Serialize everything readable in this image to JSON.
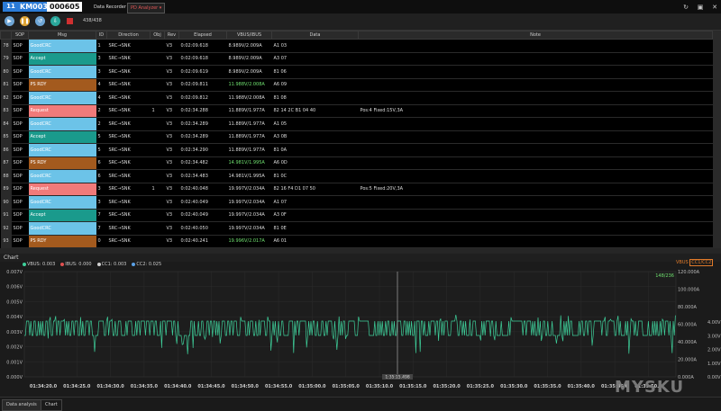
{
  "titlebar": {
    "window_number": "11",
    "device_model": "KM003C",
    "device_serial": "000605",
    "tabs": [
      "Data Recorder",
      "PD Analyzer ▾"
    ]
  },
  "toolbar": {
    "packet_count": "438/438"
  },
  "table": {
    "columns": [
      "",
      "SOP",
      "Msg",
      "ID",
      "Direction",
      "Obj",
      "Rev",
      "Elapsed",
      "VBUS/IBUS",
      "Data",
      "Note"
    ],
    "rows": [
      {
        "idx": "78",
        "sop": "SOP",
        "msg": "GoodCRC",
        "msg_color": "#6cc3e8",
        "id": "1",
        "dir": "SRC→SNK",
        "obj": "",
        "rev": "V3",
        "elapsed": "0:02:09.618",
        "vbus": "8.989V/2.009A",
        "vbus_green": false,
        "data": "A1 03",
        "note": ""
      },
      {
        "idx": "79",
        "sop": "SOP",
        "msg": "Accept",
        "msg_color": "#1a9a8c",
        "id": "3",
        "dir": "SRC→SNK",
        "obj": "",
        "rev": "V3",
        "elapsed": "0:02:09.618",
        "vbus": "8.989V/2.009A",
        "vbus_green": false,
        "data": "A3 07",
        "note": ""
      },
      {
        "idx": "80",
        "sop": "SOP",
        "msg": "GoodCRC",
        "msg_color": "#6cc3e8",
        "id": "3",
        "dir": "SRC→SNK",
        "obj": "",
        "rev": "V3",
        "elapsed": "0:02:09.619",
        "vbus": "8.989V/2.009A",
        "vbus_green": false,
        "data": "81 06",
        "note": ""
      },
      {
        "idx": "81",
        "sop": "SOP",
        "msg": "PS RDY",
        "msg_color": "#a35a1e",
        "id": "4",
        "dir": "SRC→SNK",
        "obj": "",
        "rev": "V3",
        "elapsed": "0:02:09.811",
        "vbus": "11.988V/2.008A",
        "vbus_green": true,
        "data": "A6 09",
        "note": ""
      },
      {
        "idx": "82",
        "sop": "SOP",
        "msg": "GoodCRC",
        "msg_color": "#6cc3e8",
        "id": "4",
        "dir": "SRC→SNK",
        "obj": "",
        "rev": "V3",
        "elapsed": "0:02:09.812",
        "vbus": "11.988V/2.008A",
        "vbus_green": false,
        "data": "81 08",
        "note": ""
      },
      {
        "idx": "83",
        "sop": "SOP",
        "msg": "Request",
        "msg_color": "#f07a7a",
        "id": "2",
        "dir": "SRC→SNK",
        "obj": "1",
        "rev": "V3",
        "elapsed": "0:02:34.288",
        "vbus": "11.889V/1.977A",
        "vbus_green": false,
        "data": "82 14 2C B1 04 40",
        "note": "Pos:4 Fixed:15V,3A"
      },
      {
        "idx": "84",
        "sop": "SOP",
        "msg": "GoodCRC",
        "msg_color": "#6cc3e8",
        "id": "2",
        "dir": "SRC→SNK",
        "obj": "",
        "rev": "V3",
        "elapsed": "0:02:34.289",
        "vbus": "11.889V/1.977A",
        "vbus_green": false,
        "data": "A1 05",
        "note": ""
      },
      {
        "idx": "85",
        "sop": "SOP",
        "msg": "Accept",
        "msg_color": "#1a9a8c",
        "id": "5",
        "dir": "SRC→SNK",
        "obj": "",
        "rev": "V3",
        "elapsed": "0:02:34.289",
        "vbus": "11.889V/1.977A",
        "vbus_green": false,
        "data": "A3 0B",
        "note": ""
      },
      {
        "idx": "86",
        "sop": "SOP",
        "msg": "GoodCRC",
        "msg_color": "#6cc3e8",
        "id": "5",
        "dir": "SRC→SNK",
        "obj": "",
        "rev": "V3",
        "elapsed": "0:02:34.290",
        "vbus": "11.889V/1.977A",
        "vbus_green": false,
        "data": "81 0A",
        "note": ""
      },
      {
        "idx": "87",
        "sop": "SOP",
        "msg": "PS RDY",
        "msg_color": "#a35a1e",
        "id": "6",
        "dir": "SRC→SNK",
        "obj": "",
        "rev": "V3",
        "elapsed": "0:02:34.482",
        "vbus": "14.981V/1.995A",
        "vbus_green": true,
        "data": "A6 0D",
        "note": ""
      },
      {
        "idx": "88",
        "sop": "SOP",
        "msg": "GoodCRC",
        "msg_color": "#6cc3e8",
        "id": "6",
        "dir": "SRC→SNK",
        "obj": "",
        "rev": "V3",
        "elapsed": "0:02:34.483",
        "vbus": "14.981V/1.995A",
        "vbus_green": false,
        "data": "81 0C",
        "note": ""
      },
      {
        "idx": "89",
        "sop": "SOP",
        "msg": "Request",
        "msg_color": "#f07a7a",
        "id": "3",
        "dir": "SRC→SNK",
        "obj": "1",
        "rev": "V3",
        "elapsed": "0:02:40.048",
        "vbus": "19.997V/2.034A",
        "vbus_green": false,
        "data": "82 16 F4 D1 07 50",
        "note": "Pos:5 Fixed:20V,3A"
      },
      {
        "idx": "90",
        "sop": "SOP",
        "msg": "GoodCRC",
        "msg_color": "#6cc3e8",
        "id": "3",
        "dir": "SRC→SNK",
        "obj": "",
        "rev": "V3",
        "elapsed": "0:02:40.049",
        "vbus": "19.997V/2.034A",
        "vbus_green": false,
        "data": "A1 07",
        "note": ""
      },
      {
        "idx": "91",
        "sop": "SOP",
        "msg": "Accept",
        "msg_color": "#1a9a8c",
        "id": "7",
        "dir": "SRC→SNK",
        "obj": "",
        "rev": "V3",
        "elapsed": "0:02:40.049",
        "vbus": "19.997V/2.034A",
        "vbus_green": false,
        "data": "A3 0F",
        "note": ""
      },
      {
        "idx": "92",
        "sop": "SOP",
        "msg": "GoodCRC",
        "msg_color": "#6cc3e8",
        "id": "7",
        "dir": "SRC→SNK",
        "obj": "",
        "rev": "V3",
        "elapsed": "0:02:40.050",
        "vbus": "19.997V/2.034A",
        "vbus_green": false,
        "data": "81 0E",
        "note": ""
      },
      {
        "idx": "93",
        "sop": "SOP",
        "msg": "PS RDY",
        "msg_color": "#a35a1e",
        "id": "0",
        "dir": "SRC→SNK",
        "obj": "",
        "rev": "V3",
        "elapsed": "0:02:40.241",
        "vbus": "19.996V/2.017A",
        "vbus_green": true,
        "data": "A6 01",
        "note": ""
      }
    ]
  },
  "chart": {
    "title": "Chart",
    "legend": [
      {
        "label": "VBUS: 0.003",
        "color": "#3ecf9a"
      },
      {
        "label": "IBUS: 0.000",
        "color": "#e05050"
      },
      {
        "label": "CC1: 0.003",
        "color": "#d0d0d0"
      },
      {
        "label": "CC2: 0.025",
        "color": "#5aa0e6"
      }
    ],
    "right_tabs": [
      "VBUS",
      "CC1/CC2"
    ],
    "top_right_readout": "148/236",
    "cursor_label": "1:35:15.498",
    "left_axis": [
      "0.007V",
      "0.006V",
      "0.005V",
      "0.004V",
      "0.003V",
      "0.002V",
      "0.001V",
      "0.000V"
    ],
    "amp_axis": [
      "120.000A",
      "100.000A",
      "80.000A",
      "60.000A",
      "40.000A",
      "20.000A",
      "0.000A"
    ],
    "cc_axis": [
      "4.00V",
      "3.00V",
      "2.00V",
      "1.00V",
      "0.00V"
    ],
    "x_ticks": [
      "01:34:20.0",
      "01:34:25.0",
      "01:34:30.0",
      "01:34:35.0",
      "01:34:40.0",
      "01:34:45.0",
      "01:34:50.0",
      "01:34:55.0",
      "01:35:00.0",
      "01:35:05.0",
      "01:35:10.0",
      "01:35:15.0",
      "01:35:20.0",
      "01:35:25.0",
      "01:35:30.0",
      "01:35:35.0",
      "01:35:40.0",
      "01:35:45.0",
      "01:35:50.0"
    ],
    "colors": {
      "vbus": "#3ecf9a",
      "grid": "#2c2c2c",
      "cursor": "#bbbbbb"
    }
  },
  "bottom_tabs": [
    "Data analysis",
    "Chart"
  ],
  "watermark": "MYSKU"
}
